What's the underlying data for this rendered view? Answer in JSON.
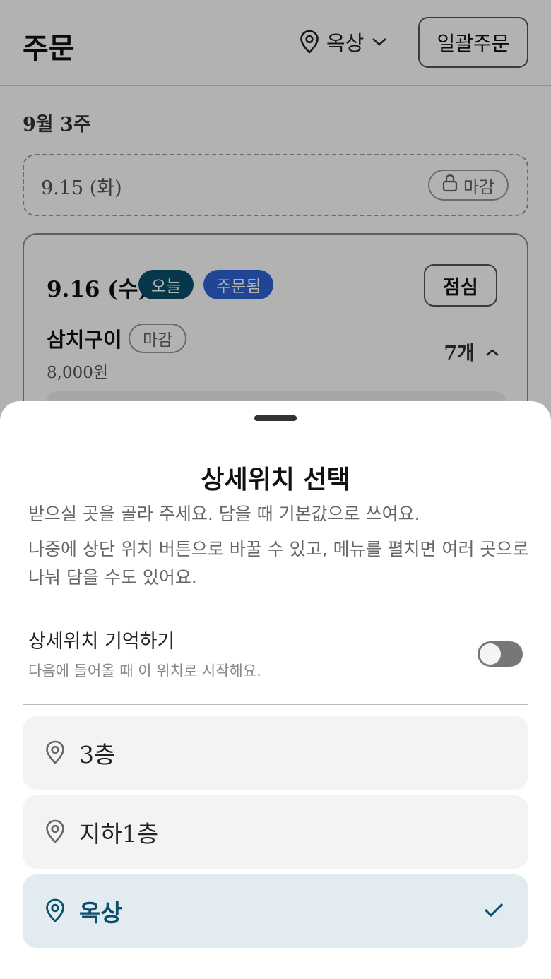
{
  "header": {
    "title": "주문",
    "location": "옥상",
    "bulk_order_label": "일괄주문"
  },
  "week": {
    "label": "9월 3주",
    "days": [
      {
        "date": "9.15 (화)",
        "status": "마감"
      },
      {
        "date": "9.16 (수)",
        "today_badge": "오늘",
        "ordered_badge": "주문됨",
        "meal_button": "점심",
        "menu": {
          "name": "삼치구이",
          "status": "마감",
          "price": "8,000원",
          "quantity": "7개"
        }
      }
    ]
  },
  "sheet": {
    "title": "상세위치 선택",
    "description_1": "받으실 곳을 골라 주세요. 담을 때 기본값으로 쓰여요.",
    "description_2": "나중에 상단 위치 버튼으로 바꿀 수 있고, 메뉴를 펼치면 여러 곳으로 나눠 담을 수도 있어요.",
    "remember": {
      "label": "상세위치 기억하기",
      "sublabel": "다음에 들어올 때 이 위치로 시작해요.",
      "enabled": false
    },
    "options": [
      {
        "label": "3층",
        "selected": false
      },
      {
        "label": "지하1층",
        "selected": false
      },
      {
        "label": "옥상",
        "selected": true
      }
    ]
  },
  "colors": {
    "accent": "#0b4f6a",
    "ordered": "#2e63d6",
    "selected_bg": "#e2ebef"
  }
}
